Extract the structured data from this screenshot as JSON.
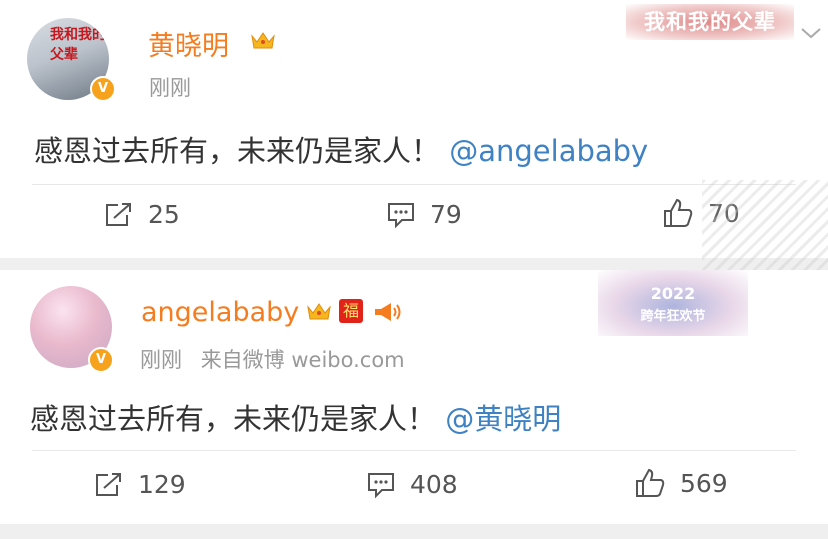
{
  "posts": [
    {
      "author": "黄晓明",
      "meta": [
        "刚刚"
      ],
      "text": "感恩过去所有，未来仍是家人！",
      "mention": "@angelababy",
      "avatar_tag": "我和我的父辈",
      "stamp": "我和我的父辈",
      "reposts": "25",
      "comments": "79",
      "likes": "70"
    },
    {
      "author": "angelababy",
      "meta": [
        "刚刚",
        "来自微博 weibo.com"
      ],
      "text": "感恩过去所有，未来仍是家人！",
      "mention": "@黄晓明",
      "fu_badge": "福",
      "stamp_year": "2022",
      "stamp_sub": "跨年狂欢节",
      "reposts": "129",
      "comments": "408",
      "likes": "569"
    }
  ],
  "icons": {
    "verified": "verified-v-icon",
    "crown": "crown-icon",
    "repost": "repost-icon",
    "comment": "comment-icon",
    "like": "thumbs-up-icon",
    "horn": "megaphone-icon",
    "more": "chevron-down-icon"
  },
  "colors": {
    "name": "#f57c1f",
    "mention": "#3f82c4",
    "verified": "#f7a21d",
    "meta": "#999999"
  }
}
